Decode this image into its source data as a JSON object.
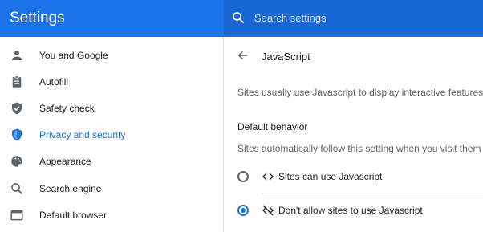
{
  "header": {
    "title": "Settings",
    "search_placeholder": "Search settings"
  },
  "sidebar": {
    "items": [
      {
        "label": "You and Google",
        "icon": "person-icon"
      },
      {
        "label": "Autofill",
        "icon": "clipboard-icon"
      },
      {
        "label": "Safety check",
        "icon": "shield-check-icon"
      },
      {
        "label": "Privacy and security",
        "icon": "shield-icon",
        "active": true
      },
      {
        "label": "Appearance",
        "icon": "palette-icon"
      },
      {
        "label": "Search engine",
        "icon": "search-icon"
      },
      {
        "label": "Default browser",
        "icon": "browser-window-icon"
      }
    ]
  },
  "main": {
    "page_title": "JavaScript",
    "description": "Sites usually use Javascript to display interactive features, like v",
    "default_behavior": {
      "title": "Default behavior",
      "description": "Sites automatically follow this setting when you visit them",
      "options": [
        {
          "label": "Sites can use Javascript",
          "icon": "code-icon",
          "checked": false
        },
        {
          "label": "Don't allow sites to use Javascript",
          "icon": "code-off-icon",
          "checked": true
        }
      ]
    }
  },
  "colors": {
    "accent": "#1a73e8",
    "header_bg": "#1a73e8",
    "search_bg": "#1967d2"
  }
}
